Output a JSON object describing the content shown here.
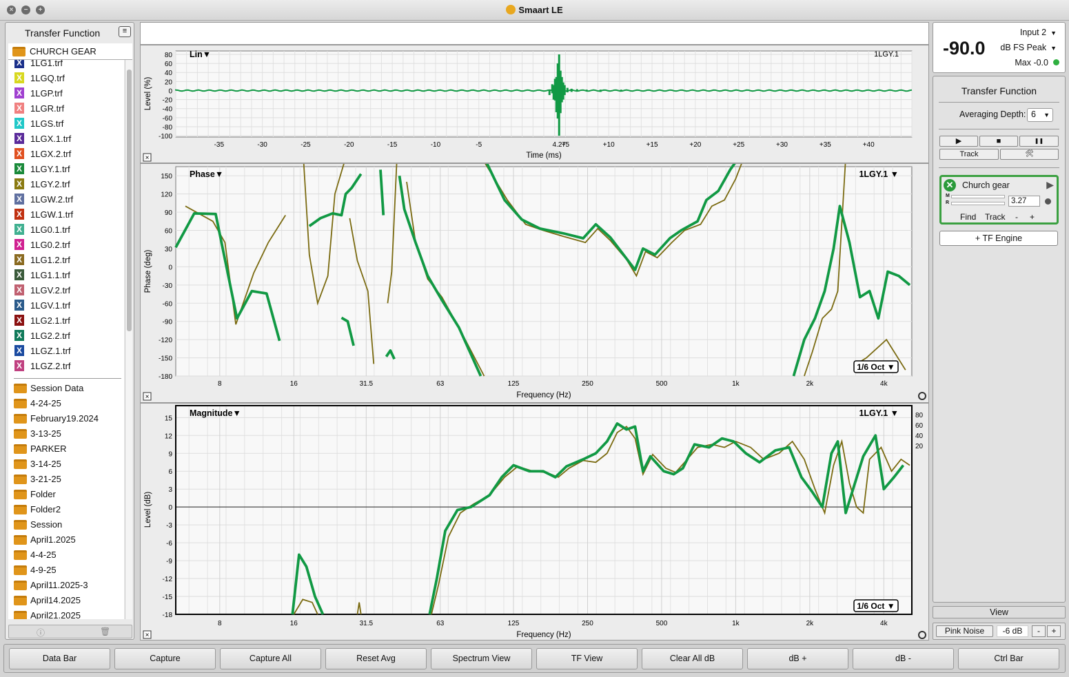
{
  "window": {
    "title": "Smaart LE"
  },
  "left_panel": {
    "header": "Transfer Function",
    "root_folder": "CHURCH GEAR",
    "files": [
      {
        "name": "1LG1.trf",
        "color": "#1a2f8a"
      },
      {
        "name": "1LGQ.trf",
        "color": "#d8d820"
      },
      {
        "name": "1LGP.trf",
        "color": "#a040d0"
      },
      {
        "name": "1LGR.trf",
        "color": "#f08080"
      },
      {
        "name": "1LGS.trf",
        "color": "#20c8c8"
      },
      {
        "name": "1LGX.1.trf",
        "color": "#5a2a9a"
      },
      {
        "name": "1LGX.2.trf",
        "color": "#e05020"
      },
      {
        "name": "1LGY.1.trf",
        "color": "#1a8a3a"
      },
      {
        "name": "1LGY.2.trf",
        "color": "#8a7a10"
      },
      {
        "name": "1LGW.2.trf",
        "color": "#6070a0"
      },
      {
        "name": "1LGW.1.trf",
        "color": "#c03010"
      },
      {
        "name": "1LG0.1.trf",
        "color": "#40b090"
      },
      {
        "name": "1LG0.2.trf",
        "color": "#d02090"
      },
      {
        "name": "1LG1.2.trf",
        "color": "#8a6a20"
      },
      {
        "name": "1LG1.1.trf",
        "color": "#3a5a3a"
      },
      {
        "name": "1LGV.2.trf",
        "color": "#c06070"
      },
      {
        "name": "1LGV.1.trf",
        "color": "#2a5a8a"
      },
      {
        "name": "1LG2.1.trf",
        "color": "#8a1010"
      },
      {
        "name": "1LG2.2.trf",
        "color": "#107a5a"
      },
      {
        "name": "1LGZ.1.trf",
        "color": "#1a4aa0"
      },
      {
        "name": "1LGZ.2.trf",
        "color": "#c04080"
      }
    ],
    "folders": [
      "Session Data",
      "4-24-25",
      "February19.2024",
      "3-13-25",
      "PARKER",
      "3-14-25",
      "3-21-25",
      "Folder",
      "Folder2",
      "Session",
      "April1.2025",
      "4-4-25",
      "4-9-25",
      "April11.2025-3",
      "April14.2025",
      "April21.2025"
    ]
  },
  "impulse_plot": {
    "mode_label": "Lin▼",
    "trace_label": "1LGY.1",
    "ylabel": "Level (%)",
    "xlabel": "Time (ms)",
    "yticks": [
      "80",
      "60",
      "40",
      "20",
      "0",
      "-20",
      "-40",
      "-60",
      "-80",
      "-100"
    ],
    "xticks": [
      "-35",
      "-30",
      "-25",
      "-20",
      "-15",
      "-10",
      "-5",
      "4.27",
      "+5",
      "+10",
      "+15",
      "+20",
      "+25",
      "+30",
      "+35",
      "+40"
    ]
  },
  "phase_plot": {
    "mode_label": "Phase▼",
    "trace_label": "1LGY.1 ▼",
    "ylabel": "Phase (deg)",
    "xlabel": "Frequency (Hz)",
    "yticks": [
      "150",
      "120",
      "90",
      "60",
      "30",
      "0",
      "-30",
      "-60",
      "-90",
      "-120",
      "-150",
      "-180"
    ],
    "xticks": [
      "8",
      "16",
      "31.5",
      "63",
      "125",
      "250",
      "500",
      "1k",
      "2k",
      "4k"
    ],
    "smoothing": "1/6 Oct ▼"
  },
  "magnitude_plot": {
    "mode_label": "Magnitude▼",
    "trace_label": "1LGY.1 ▼",
    "ylabel": "Level (dB)",
    "xlabel": "Frequency (Hz)",
    "yticks": [
      "15",
      "12",
      "9",
      "6",
      "3",
      "0",
      "-3",
      "-6",
      "-9",
      "-12",
      "-15",
      "-18"
    ],
    "xticks": [
      "8",
      "16",
      "31.5",
      "63",
      "125",
      "250",
      "500",
      "1k",
      "2k",
      "4k"
    ],
    "coherence_ticks": [
      "80",
      "60",
      "40",
      "20"
    ],
    "smoothing": "1/6 Oct ▼"
  },
  "meter": {
    "value": "-90.0",
    "input": "Input 2",
    "mode": "dB FS Peak",
    "max": "Max -0.0",
    "dot_color": "#2fb040"
  },
  "tf_panel": {
    "header": "Transfer Function",
    "avg_label": "Averaging Depth:",
    "avg_value": "6",
    "play": "▶",
    "stop": "■",
    "pause": "❚❚",
    "track": "Track",
    "tools": "🛠",
    "engine": {
      "name": "Church gear",
      "delay": "3.27",
      "find": "Find",
      "track": "Track",
      "minus": "-",
      "plus": "+",
      "m": "M",
      "r": "R"
    },
    "add_engine": "+ TF Engine",
    "view": "View",
    "pink_noise": "Pink Noise",
    "noise_level": "-6 dB",
    "noise_minus": "-",
    "noise_plus": "+"
  },
  "bottom_buttons": [
    "Data Bar",
    "Capture",
    "Capture All",
    "Reset Avg",
    "Spectrum View",
    "TF View",
    "Clear All dB",
    "dB +",
    "dB -",
    "Ctrl Bar"
  ],
  "colors": {
    "live_trace": "#119944",
    "captured_trace": "#7a6a10",
    "accent": "#3aa040"
  }
}
